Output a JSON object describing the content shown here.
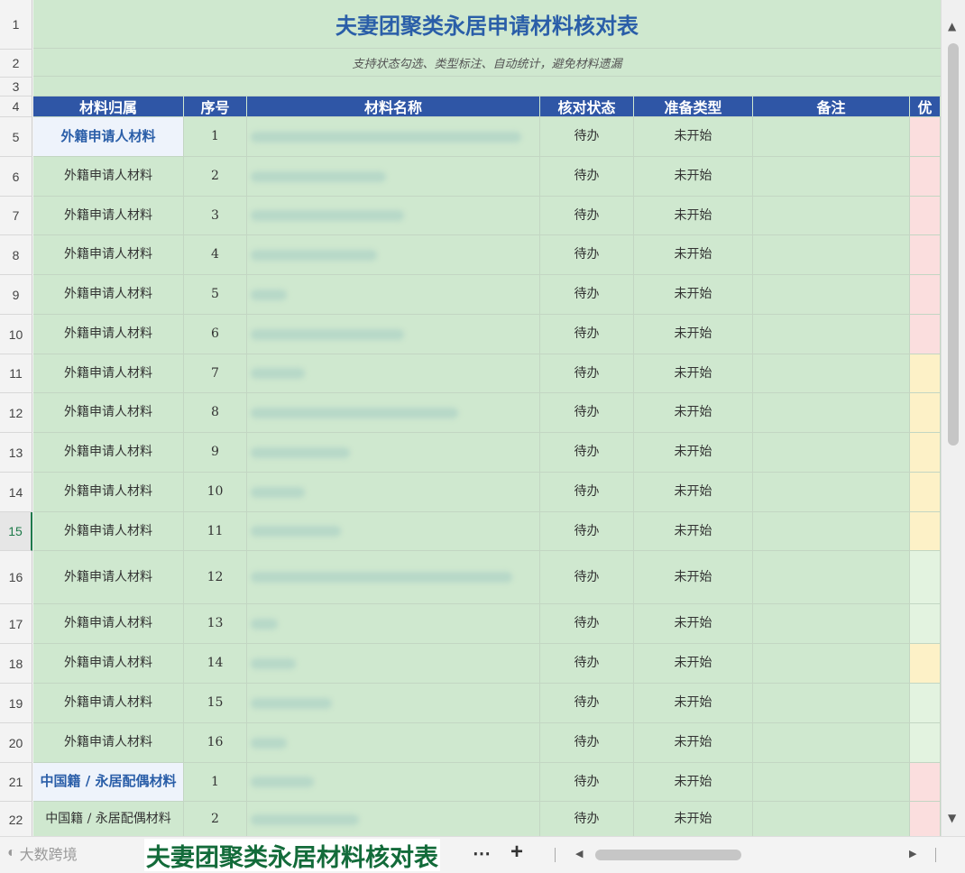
{
  "sheet": {
    "title": "夫妻团聚类永居申请材料核对表",
    "subtitle": "支持状态勾选、类型标注、自动统计，避免材料遗漏",
    "headers": [
      "材料归属",
      "序号",
      "材料名称",
      "核对状态",
      "准备类型",
      "备注",
      "优"
    ],
    "rows": [
      {
        "group": "外籍申请人材料",
        "no": "1",
        "status": "待办",
        "type": "未开始",
        "prio": "#fbdede"
      },
      {
        "group": "外籍申请人材料",
        "no": "2",
        "status": "待办",
        "type": "未开始",
        "prio": "#fbdede"
      },
      {
        "group": "外籍申请人材料",
        "no": "3",
        "status": "待办",
        "type": "未开始",
        "prio": "#fbdede"
      },
      {
        "group": "外籍申请人材料",
        "no": "4",
        "status": "待办",
        "type": "未开始",
        "prio": "#fbdede"
      },
      {
        "group": "外籍申请人材料",
        "no": "5",
        "status": "待办",
        "type": "未开始",
        "prio": "#fbdede"
      },
      {
        "group": "外籍申请人材料",
        "no": "6",
        "status": "待办",
        "type": "未开始",
        "prio": "#fbdede"
      },
      {
        "group": "外籍申请人材料",
        "no": "7",
        "status": "待办",
        "type": "未开始",
        "prio": "#fdf1c7"
      },
      {
        "group": "外籍申请人材料",
        "no": "8",
        "status": "待办",
        "type": "未开始",
        "prio": "#fdf1c7"
      },
      {
        "group": "外籍申请人材料",
        "no": "9",
        "status": "待办",
        "type": "未开始",
        "prio": "#fdf1c7"
      },
      {
        "group": "外籍申请人材料",
        "no": "10",
        "status": "待办",
        "type": "未开始",
        "prio": "#fdf1c7"
      },
      {
        "group": "外籍申请人材料",
        "no": "11",
        "status": "待办",
        "type": "未开始",
        "prio": "#fdf1c7"
      },
      {
        "group": "外籍申请人材料",
        "no": "12",
        "status": "待办",
        "type": "未开始",
        "prio": "#e3f3e0"
      },
      {
        "group": "外籍申请人材料",
        "no": "13",
        "status": "待办",
        "type": "未开始",
        "prio": "#e3f3e0"
      },
      {
        "group": "外籍申请人材料",
        "no": "14",
        "status": "待办",
        "type": "未开始",
        "prio": "#fdf1c7"
      },
      {
        "group": "外籍申请人材料",
        "no": "15",
        "status": "待办",
        "type": "未开始",
        "prio": "#e3f3e0"
      },
      {
        "group": "外籍申请人材料",
        "no": "16",
        "status": "待办",
        "type": "未开始",
        "prio": "#e3f3e0"
      },
      {
        "group": "中国籍 / 永居配偶材料",
        "no": "1",
        "status": "待办",
        "type": "未开始",
        "prio": "#fbdede"
      },
      {
        "group": "中国籍 / 永居配偶材料",
        "no": "2",
        "status": "待办",
        "type": "未开始",
        "prio": "#fbdede"
      }
    ]
  },
  "row_numbers": [
    "1",
    "2",
    "3",
    "4",
    "5",
    "6",
    "7",
    "8",
    "9",
    "10",
    "11",
    "12",
    "13",
    "14",
    "15",
    "16",
    "17",
    "18",
    "19",
    "20",
    "21",
    "22"
  ],
  "bottom_bar": {
    "logo_text": "大数跨境",
    "sheet_tab": "夫妻团聚类永居材料核对表",
    "more": "⋯",
    "add": "+"
  }
}
